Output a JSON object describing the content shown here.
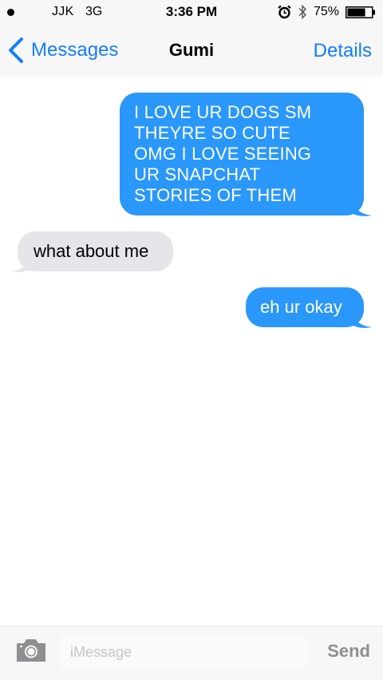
{
  "status_bar": {
    "carrier": "JJK",
    "network": "3G",
    "time": "3:36 PM",
    "battery_percent": "75%",
    "battery_level": 0.75,
    "icons": [
      "signal-dot-icon",
      "alarm-icon",
      "bluetooth-icon",
      "battery-icon"
    ]
  },
  "nav": {
    "back_label": "Messages",
    "contact_name": "Gumi",
    "details_label": "Details"
  },
  "messages": [
    {
      "direction": "sent",
      "lines": [
        "I LOVE UR DOGS SM",
        "THEYRE SO CUTE",
        "OMG I LOVE SEEING",
        "UR SNAPCHAT",
        "STORIES OF THEM"
      ]
    },
    {
      "direction": "received",
      "text": "what about me"
    },
    {
      "direction": "sent",
      "text": "eh ur okay"
    }
  ],
  "input": {
    "placeholder": "iMessage",
    "value": "",
    "send_label": "Send"
  },
  "colors": {
    "accent": "#157efb",
    "sent_bubble": "#2a97fa",
    "received_bubble": "#e5e5ea",
    "bar_background": "#f7f7f7",
    "send_disabled": "#8e8e93"
  }
}
